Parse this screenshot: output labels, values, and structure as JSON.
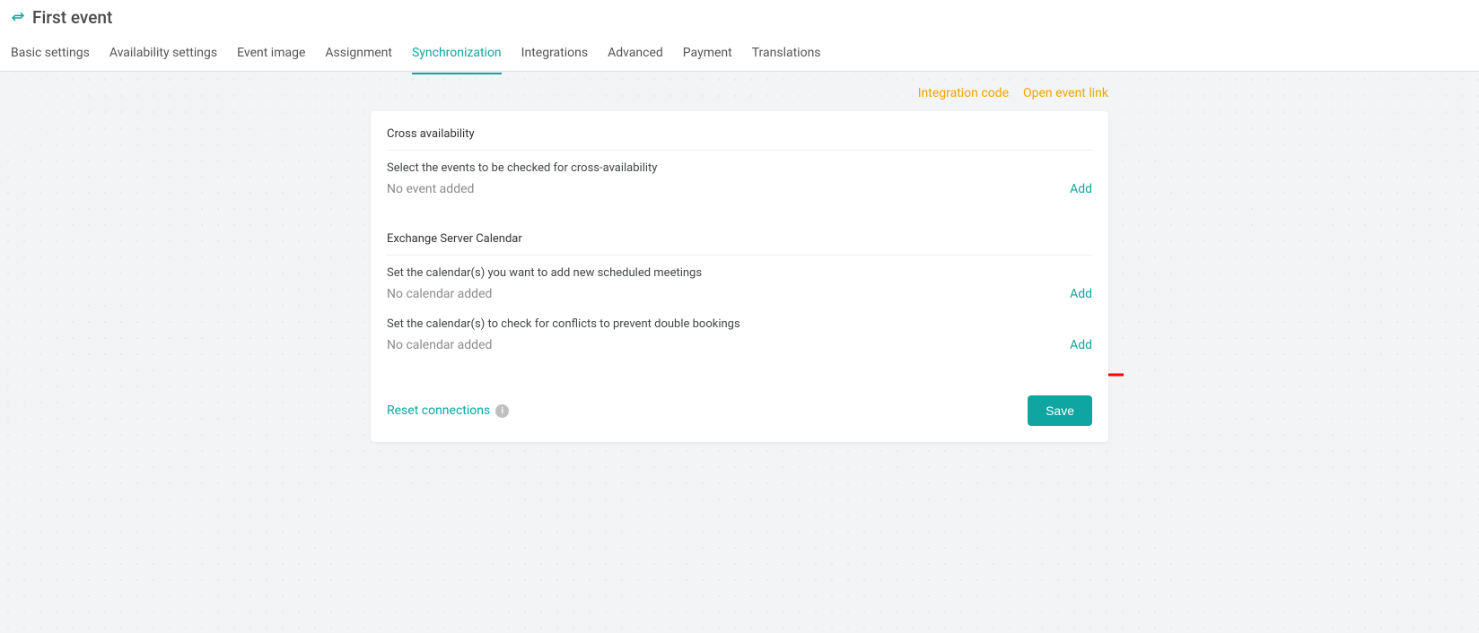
{
  "header": {
    "title": "First event",
    "tabs": [
      "Basic settings",
      "Availability settings",
      "Event image",
      "Assignment",
      "Synchronization",
      "Integrations",
      "Advanced",
      "Payment",
      "Translations"
    ],
    "active_tab_index": 4
  },
  "top_links": {
    "integration_code": "Integration code",
    "open_event_link": "Open event link"
  },
  "cross_availability": {
    "title": "Cross availability",
    "desc": "Select the events to be checked for cross-availability",
    "placeholder": "No event added",
    "add_label": "Add"
  },
  "exchange": {
    "title": "Exchange Server Calendar",
    "add_desc": "Set the calendar(s) you want to add new scheduled meetings",
    "add_placeholder": "No calendar added",
    "add_label": "Add",
    "conflict_desc": "Set the calendar(s) to check for conflicts to prevent double bookings",
    "conflict_placeholder": "No calendar added",
    "conflict_add_label": "Add"
  },
  "footer": {
    "reset_label": "Reset connections",
    "save_label": "Save"
  },
  "colors": {
    "accent": "#0fa5a0",
    "link_orange": "#f0a500",
    "annotation_red": "#ff0000"
  }
}
